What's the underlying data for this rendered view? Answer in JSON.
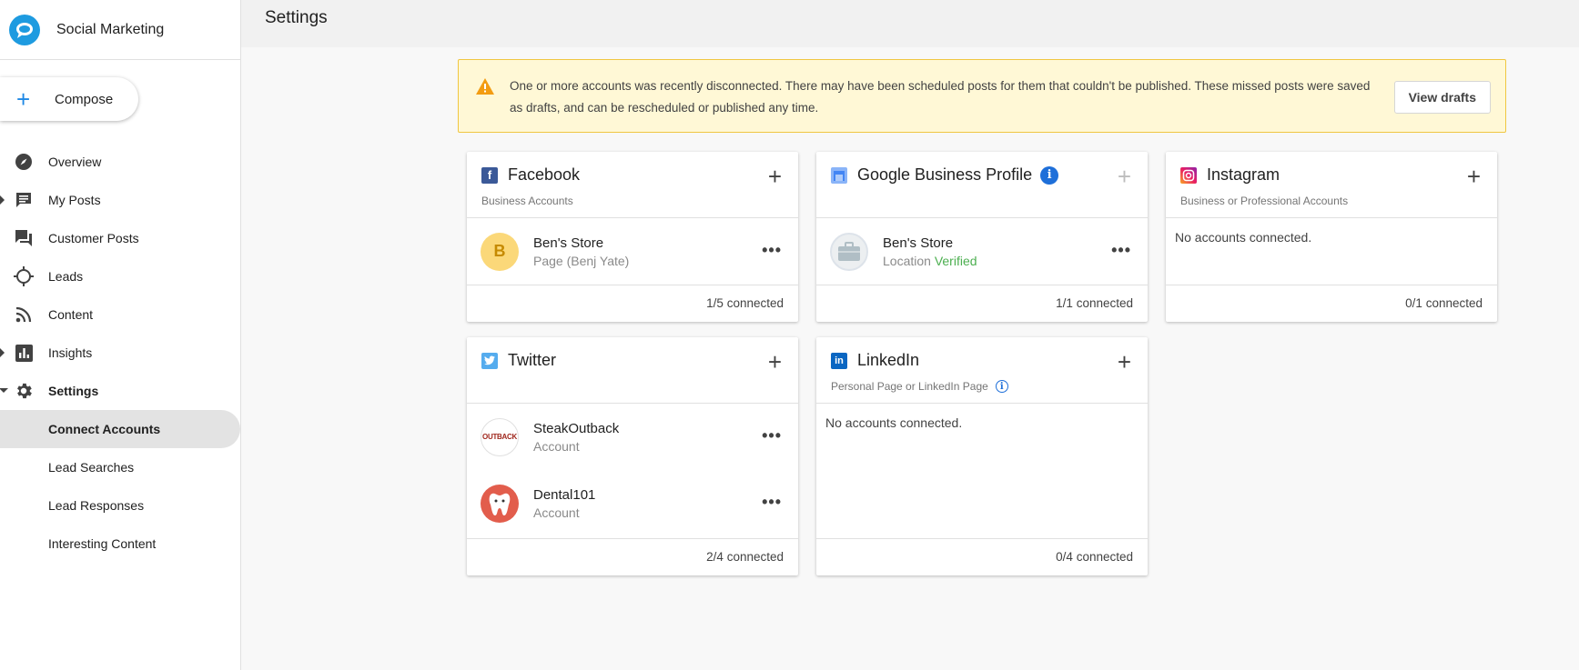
{
  "app": {
    "name": "Social Marketing",
    "logo_icon": "chat-bubble-icon"
  },
  "compose": {
    "label": "Compose"
  },
  "nav": {
    "items": [
      {
        "label": "Overview",
        "icon": "compass-icon"
      },
      {
        "label": "My Posts",
        "icon": "posts-icon"
      },
      {
        "label": "Customer Posts",
        "icon": "forum-icon"
      },
      {
        "label": "Leads",
        "icon": "crosshair-icon"
      },
      {
        "label": "Content",
        "icon": "rss-icon"
      },
      {
        "label": "Insights",
        "icon": "bar-chart-icon"
      },
      {
        "label": "Settings",
        "icon": "gear-icon"
      }
    ],
    "sub_items": [
      {
        "label": "Connect Accounts"
      },
      {
        "label": "Lead Searches"
      },
      {
        "label": "Lead Responses"
      },
      {
        "label": "Interesting Content"
      }
    ]
  },
  "header": {
    "title": "Settings"
  },
  "alert": {
    "text": "One or more accounts was recently disconnected. There may have been scheduled posts for them that couldn't be published. These missed posts were saved as drafts, and can be rescheduled or published any time.",
    "button_label": "View drafts",
    "icon": "warning-icon",
    "color": "#fff8d6"
  },
  "cards": {
    "facebook": {
      "title": "Facebook",
      "subtitle": "Business Accounts",
      "accounts": [
        {
          "initial": "B",
          "name": "Ben's Store",
          "type": "Page (Benj Yate)"
        }
      ],
      "footer": "1/5 connected",
      "color": "#3b5998"
    },
    "google": {
      "title": "Google Business Profile",
      "accounts": [
        {
          "name": "Ben's Store",
          "type": "Location",
          "status": "Verified"
        }
      ],
      "footer": "1/1 connected",
      "color": "#4285f4"
    },
    "instagram": {
      "title": "Instagram",
      "subtitle": "Business or Professional Accounts",
      "empty": "No accounts connected.",
      "footer": "0/1 connected"
    },
    "twitter": {
      "title": "Twitter",
      "accounts": [
        {
          "name": "SteakOutback",
          "type": "Account",
          "logo_text": "OUTBACK"
        },
        {
          "name": "Dental101",
          "type": "Account"
        }
      ],
      "footer": "2/4 connected",
      "color": "#55acee"
    },
    "linkedin": {
      "title": "LinkedIn",
      "subtitle": "Personal Page or LinkedIn Page",
      "empty": "No accounts connected.",
      "footer": "0/4 connected",
      "color": "#0a66c2"
    }
  }
}
